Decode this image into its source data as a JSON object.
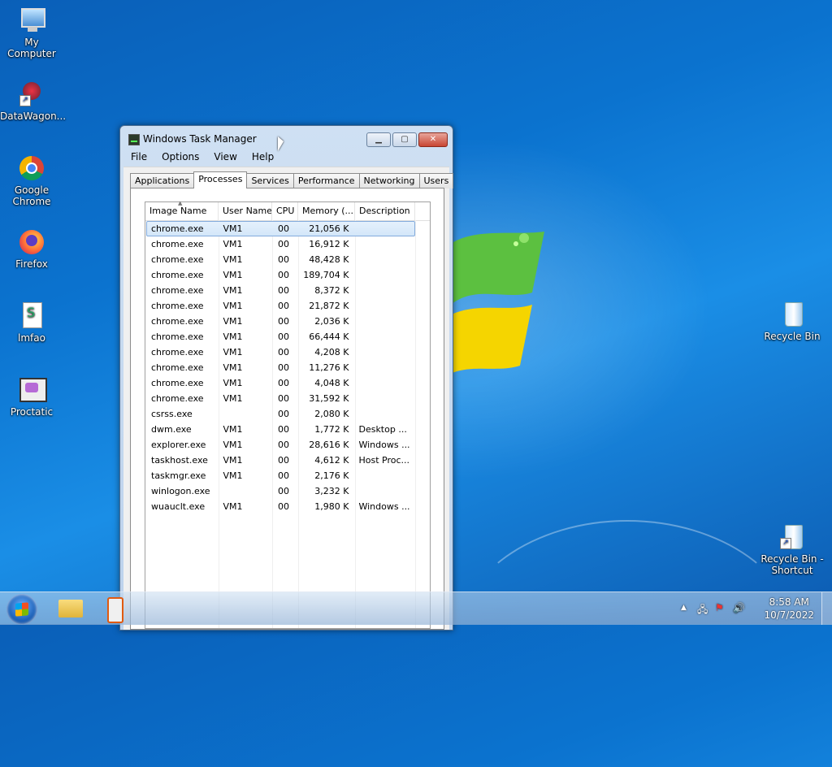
{
  "desktop": {
    "icons_left": [
      {
        "label": "My Computer",
        "icon": "computer-icon"
      },
      {
        "label": "DataWagon...",
        "icon": "datawagon-shortcut-icon"
      },
      {
        "label": "Google Chrome",
        "icon": "chrome-icon"
      },
      {
        "label": "Firefox",
        "icon": "firefox-icon"
      },
      {
        "label": "lmfao",
        "icon": "script-file-icon"
      },
      {
        "label": "Proctatic",
        "icon": "proctatic-icon"
      }
    ],
    "icons_right": [
      {
        "label": "Recycle Bin",
        "icon": "recycle-bin-icon"
      },
      {
        "label": "Recycle Bin - Shortcut",
        "icon": "recycle-bin-shortcut-icon"
      }
    ]
  },
  "task_manager": {
    "title": "Windows Task Manager",
    "menu": [
      "File",
      "Options",
      "View",
      "Help"
    ],
    "tabs": [
      "Applications",
      "Processes",
      "Services",
      "Performance",
      "Networking",
      "Users"
    ],
    "active_tab": "Processes",
    "columns": [
      "Image Name",
      "User Name",
      "CPU",
      "Memory (...",
      "Description"
    ],
    "processes": [
      {
        "image": "chrome.exe",
        "user": "VM1",
        "cpu": "00",
        "mem": "21,056 K",
        "desc": ""
      },
      {
        "image": "chrome.exe",
        "user": "VM1",
        "cpu": "00",
        "mem": "16,912 K",
        "desc": ""
      },
      {
        "image": "chrome.exe",
        "user": "VM1",
        "cpu": "00",
        "mem": "48,428 K",
        "desc": ""
      },
      {
        "image": "chrome.exe",
        "user": "VM1",
        "cpu": "00",
        "mem": "189,704 K",
        "desc": ""
      },
      {
        "image": "chrome.exe",
        "user": "VM1",
        "cpu": "00",
        "mem": "8,372 K",
        "desc": ""
      },
      {
        "image": "chrome.exe",
        "user": "VM1",
        "cpu": "00",
        "mem": "21,872 K",
        "desc": ""
      },
      {
        "image": "chrome.exe",
        "user": "VM1",
        "cpu": "00",
        "mem": "2,036 K",
        "desc": ""
      },
      {
        "image": "chrome.exe",
        "user": "VM1",
        "cpu": "00",
        "mem": "66,444 K",
        "desc": ""
      },
      {
        "image": "chrome.exe",
        "user": "VM1",
        "cpu": "00",
        "mem": "4,208 K",
        "desc": ""
      },
      {
        "image": "chrome.exe",
        "user": "VM1",
        "cpu": "00",
        "mem": "11,276 K",
        "desc": ""
      },
      {
        "image": "chrome.exe",
        "user": "VM1",
        "cpu": "00",
        "mem": "4,048 K",
        "desc": ""
      },
      {
        "image": "chrome.exe",
        "user": "VM1",
        "cpu": "00",
        "mem": "31,592 K",
        "desc": ""
      },
      {
        "image": "csrss.exe",
        "user": "",
        "cpu": "00",
        "mem": "2,080 K",
        "desc": ""
      },
      {
        "image": "dwm.exe",
        "user": "VM1",
        "cpu": "00",
        "mem": "1,772 K",
        "desc": "Desktop ..."
      },
      {
        "image": "explorer.exe",
        "user": "VM1",
        "cpu": "00",
        "mem": "28,616 K",
        "desc": "Windows ..."
      },
      {
        "image": "taskhost.exe",
        "user": "VM1",
        "cpu": "00",
        "mem": "4,612 K",
        "desc": "Host Proc..."
      },
      {
        "image": "taskmgr.exe",
        "user": "VM1",
        "cpu": "00",
        "mem": "2,176 K",
        "desc": ""
      },
      {
        "image": "winlogon.exe",
        "user": "",
        "cpu": "00",
        "mem": "3,232 K",
        "desc": ""
      },
      {
        "image": "wuauclt.exe",
        "user": "VM1",
        "cpu": "00",
        "mem": "1,980 K",
        "desc": "Windows ..."
      }
    ],
    "selected_row": 0
  },
  "taskbar": {
    "time": "8:58 AM",
    "date": "10/7/2022",
    "tray_icons": [
      "show-hidden-icons-arrow",
      "network-icon",
      "action-center-flag-icon",
      "volume-icon"
    ]
  },
  "colors": {
    "desktop_blue": "#0b73cf",
    "selection": "#d3e6f9",
    "close_red": "#c84532"
  }
}
